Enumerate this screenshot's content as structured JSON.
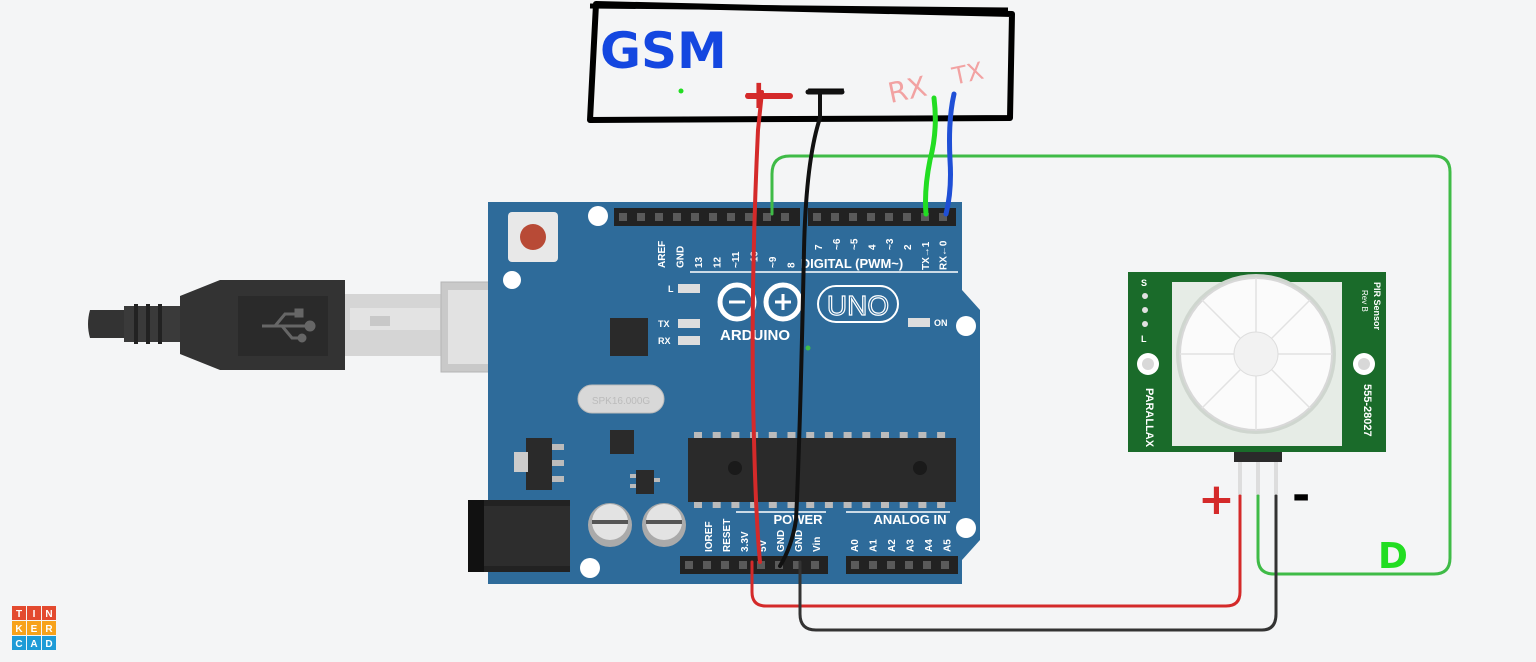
{
  "gsm": {
    "label": "GSM",
    "plus": "+",
    "minus": "—",
    "rx": "RX",
    "tx": "TX"
  },
  "arduino": {
    "brand": "ARDUINO",
    "model": "UNO",
    "digital_label": "DIGITAL (PWM~)",
    "power_label": "POWER",
    "analog_label": "ANALOG IN",
    "on_label": "ON",
    "l_label": "L",
    "tx_label": "TX",
    "rx_label": "RX",
    "crystal": "SPK16.000G",
    "digital_pins": [
      "AREF",
      "GND",
      "13",
      "12",
      "~11",
      "~10",
      "~9",
      "8",
      "7",
      "~6",
      "~5",
      "4",
      "~3",
      "2",
      "TX→1",
      "RX←0"
    ],
    "power_pins": [
      "IOREF",
      "RESET",
      "3.3V",
      "5V",
      "GND",
      "GND",
      "Vin"
    ],
    "analog_pins": [
      "A0",
      "A1",
      "A2",
      "A3",
      "A4",
      "A5"
    ]
  },
  "pir": {
    "title": "PIR Sensor",
    "rev": "Rev B",
    "part": "555-28027",
    "maker": "PARALLAX",
    "side_s": "S",
    "side_l": "L",
    "plus": "+",
    "minus": "-",
    "d_label": "D"
  },
  "tinkercad": {
    "letters": [
      "T",
      "I",
      "N",
      "K",
      "E",
      "R",
      "C",
      "A",
      "D"
    ],
    "colors": [
      "#e34a2f",
      "#e34a2f",
      "#e34a2f",
      "#f7a21b",
      "#f7a21b",
      "#f7a21b",
      "#1e9bd7",
      "#1e9bd7",
      "#1e9bd7"
    ]
  },
  "colors": {
    "board": "#2e6b9a",
    "board_dark": "#245a84",
    "wire_red": "#d42a2a",
    "wire_black": "#111111",
    "wire_green": "#3fbb47",
    "wire_bright_green": "#22dd22",
    "wire_blue": "#1f4fd6",
    "gsm_text": "#1447e0",
    "rxtx_text": "#f2a2a2",
    "pcb_green": "#1a6b2a"
  }
}
